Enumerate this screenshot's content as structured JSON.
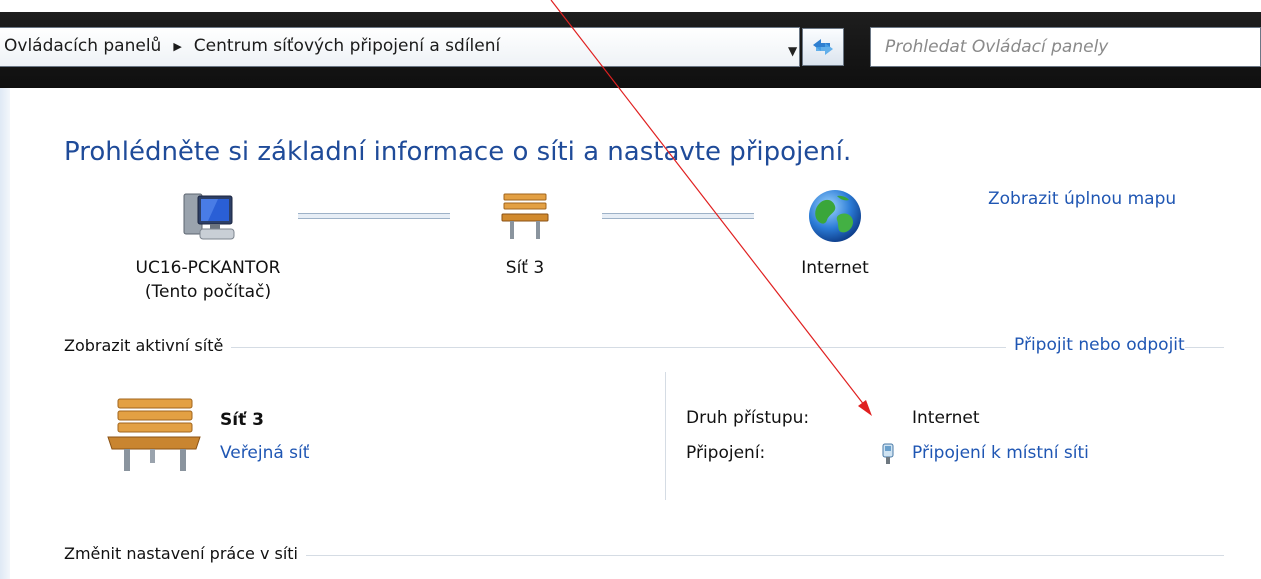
{
  "address_bar": {
    "crumbs": [
      "Ovládacích panelů",
      "Centrum síťových připojení a sdílení"
    ],
    "search_placeholder": "Prohledat Ovládací panely"
  },
  "page": {
    "title": "Prohlédněte si základní informace o síti a nastavte připojení.",
    "full_map_link": "Zobrazit úplnou mapu"
  },
  "network_map": {
    "computer_name": "UC16-PCKANTOR",
    "computer_sub": "(Tento počítač)",
    "network_name": "Síť  3",
    "internet_name": "Internet"
  },
  "active_networks": {
    "section_label": "Zobrazit aktivní sítě",
    "connect_link": "Připojit nebo odpojit",
    "network_title": "Síť  3",
    "network_type_link": "Veřejná síť",
    "access_type_label": "Druh přístupu:",
    "access_type_value": "Internet",
    "connections_label": "Připojení:",
    "connection_link": "Připojení k místní síti"
  },
  "change_settings": {
    "section_label": "Změnit nastavení práce v síti"
  },
  "colors": {
    "title": "#1f4b99",
    "link": "#1f56b3",
    "annotation_arrow": "#e02020"
  },
  "icons": [
    "computer-icon",
    "bench-icon",
    "globe-icon",
    "ethernet-icon",
    "refresh-icon",
    "chevron-down-icon",
    "breadcrumb-arrow-icon"
  ]
}
